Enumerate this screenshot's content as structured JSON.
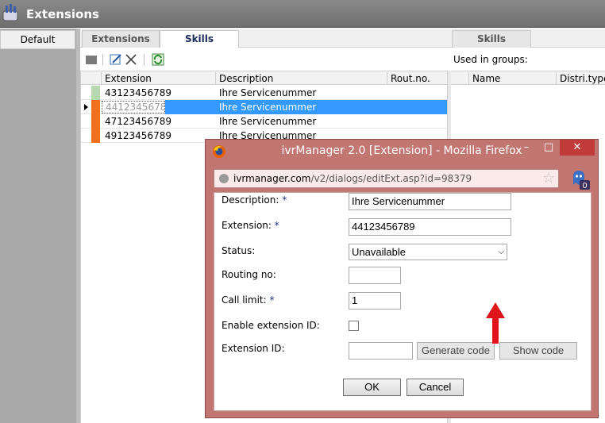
{
  "app": {
    "title": "Extensions"
  },
  "left_nav": {
    "default_label": "Default"
  },
  "tabs": [
    {
      "label": "Extensions",
      "active": false
    },
    {
      "label": "Skills",
      "active": true
    }
  ],
  "grid": {
    "columns": [
      "Extension",
      "Description",
      "Rout.no."
    ],
    "rows": [
      {
        "extension": "43123456789",
        "description": "Ihre Servicenummer",
        "rout_no": "",
        "status_color": "#b8d8b0",
        "selected": false
      },
      {
        "extension": "44123456789",
        "description": "Ihre Servicenummer",
        "rout_no": "",
        "status_color": "#f07020",
        "selected": true
      },
      {
        "extension": "47123456789",
        "description": "Ihre Servicenummer",
        "rout_no": "",
        "status_color": "#f07020",
        "selected": false
      },
      {
        "extension": "49123456789",
        "description": "Ihre Servicenummer",
        "rout_no": "",
        "status_color": "#f07020",
        "selected": false
      }
    ]
  },
  "right_panel": {
    "tab_label": "Skills",
    "used_in_groups_label": "Used in groups:",
    "columns": [
      "Name",
      "Distri.type"
    ]
  },
  "dialog": {
    "window_title": "ivrManager 2.0 [Extension] - Mozilla Firefox",
    "url_host": "ivrmanager.com",
    "url_path": "/v2/dialogs/editExt.asp?id=98379",
    "addon_badge": "0",
    "fields": {
      "description_label": "Description:",
      "description_value": "Ihre Servicenummer",
      "extension_label": "Extension:",
      "extension_value": "44123456789",
      "status_label": "Status:",
      "status_value": "Unavailable",
      "routing_label": "Routing no:",
      "routing_value": "",
      "call_limit_label": "Call limit:",
      "call_limit_value": "1",
      "enable_ext_id_label": "Enable extension ID:",
      "ext_id_label": "Extension ID:",
      "ext_id_value": "",
      "required_marker": "*"
    },
    "buttons": {
      "generate_code": "Generate code",
      "show_code": "Show code",
      "ok": "OK",
      "cancel": "Cancel"
    }
  },
  "colors": {
    "selection": "#3399ff",
    "dialog_frame": "#c27672",
    "annotation_arrow": "#e0141b"
  }
}
